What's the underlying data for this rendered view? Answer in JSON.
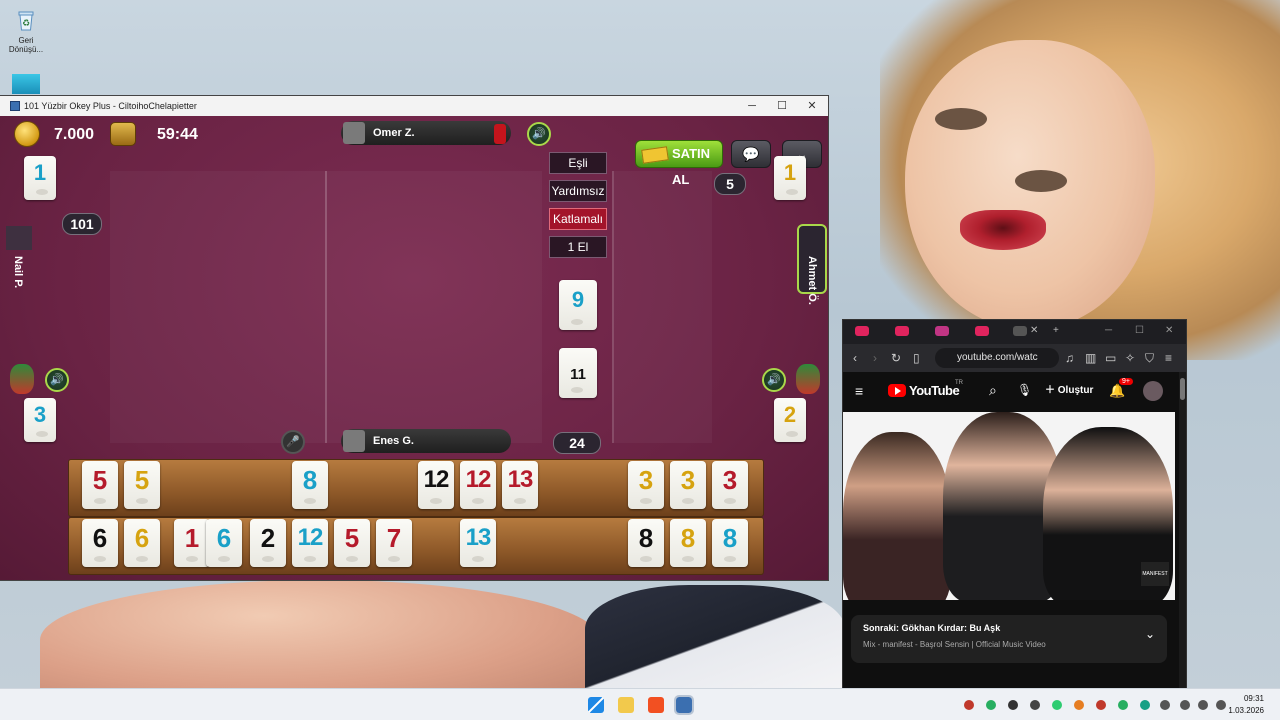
{
  "desktop": {
    "icons": [
      {
        "label": "Geri Dönüşü...",
        "icon": "recycle-bin-icon"
      },
      {
        "label": "",
        "icon": "app-shortcut-icon"
      }
    ]
  },
  "game_window": {
    "title": "101 Yüzbir Okey Plus - CiltoihoChelapietter",
    "controls": [
      "─",
      "☐",
      "✕"
    ],
    "hud": {
      "coins": "7.000",
      "timer": "59:44",
      "buy_label": "SATIN AL",
      "chat_icon": "chat-bubble-icon",
      "menu_icon": "chevron-down-icon"
    },
    "players": {
      "top": "Omer Z.",
      "bottom": "Enes G.",
      "left": "Nail P.",
      "right": "Ahmet Ö."
    },
    "badges": {
      "score_left": "101",
      "count_right": "5",
      "deck_count": "24"
    },
    "indicator_tiles": {
      "top_left": "1",
      "top_right": "1",
      "bottom_left": "3",
      "bottom_right": "2"
    },
    "modes": [
      "Eşli",
      "Yardımsız",
      "Katlamalı",
      "1 El"
    ],
    "active_mode": "Katlamalı",
    "center_tiles": {
      "indicator": "9",
      "deck": "11"
    },
    "rack_top": [
      {
        "v": "5",
        "c": "red"
      },
      {
        "v": "5",
        "c": "yellow"
      },
      {
        "v": "8",
        "c": "blue"
      },
      {
        "v": "12",
        "c": "black"
      },
      {
        "v": "12",
        "c": "red"
      },
      {
        "v": "13",
        "c": "red"
      },
      {
        "v": "3",
        "c": "yellow"
      },
      {
        "v": "3",
        "c": "yellow"
      },
      {
        "v": "3",
        "c": "red"
      }
    ],
    "rack_bottom": [
      {
        "v": "6",
        "c": "black"
      },
      {
        "v": "6",
        "c": "yellow"
      },
      {
        "v": "1",
        "c": "red"
      },
      {
        "v": "6",
        "c": "blue"
      },
      {
        "v": "2",
        "c": "black"
      },
      {
        "v": "12",
        "c": "blue"
      },
      {
        "v": "5",
        "c": "red"
      },
      {
        "v": "7",
        "c": "red"
      },
      {
        "v": "13",
        "c": "blue"
      },
      {
        "v": "8",
        "c": "black"
      },
      {
        "v": "8",
        "c": "yellow"
      },
      {
        "v": "8",
        "c": "blue"
      }
    ]
  },
  "browser": {
    "url": "youtube.com/watc",
    "site_name": "YouTube",
    "site_region": "TR",
    "create_label": "Oluştur",
    "notif_count": "9+",
    "video_watermark": "MANIFEST",
    "up_next": {
      "title": "Sonraki: Gökhan Kırdar: Bu Aşk",
      "subtitle": "Mix - manifest - Başrol Sensin | Official Music Video"
    }
  },
  "taskbar": {
    "clock_time": "09:31",
    "clock_date": "1.03.2026"
  },
  "colors": {
    "red": "#b51a2b",
    "yellow": "#d6a310",
    "blue": "#1aa0c8",
    "black": "#111111",
    "felt": "#6e2747"
  }
}
